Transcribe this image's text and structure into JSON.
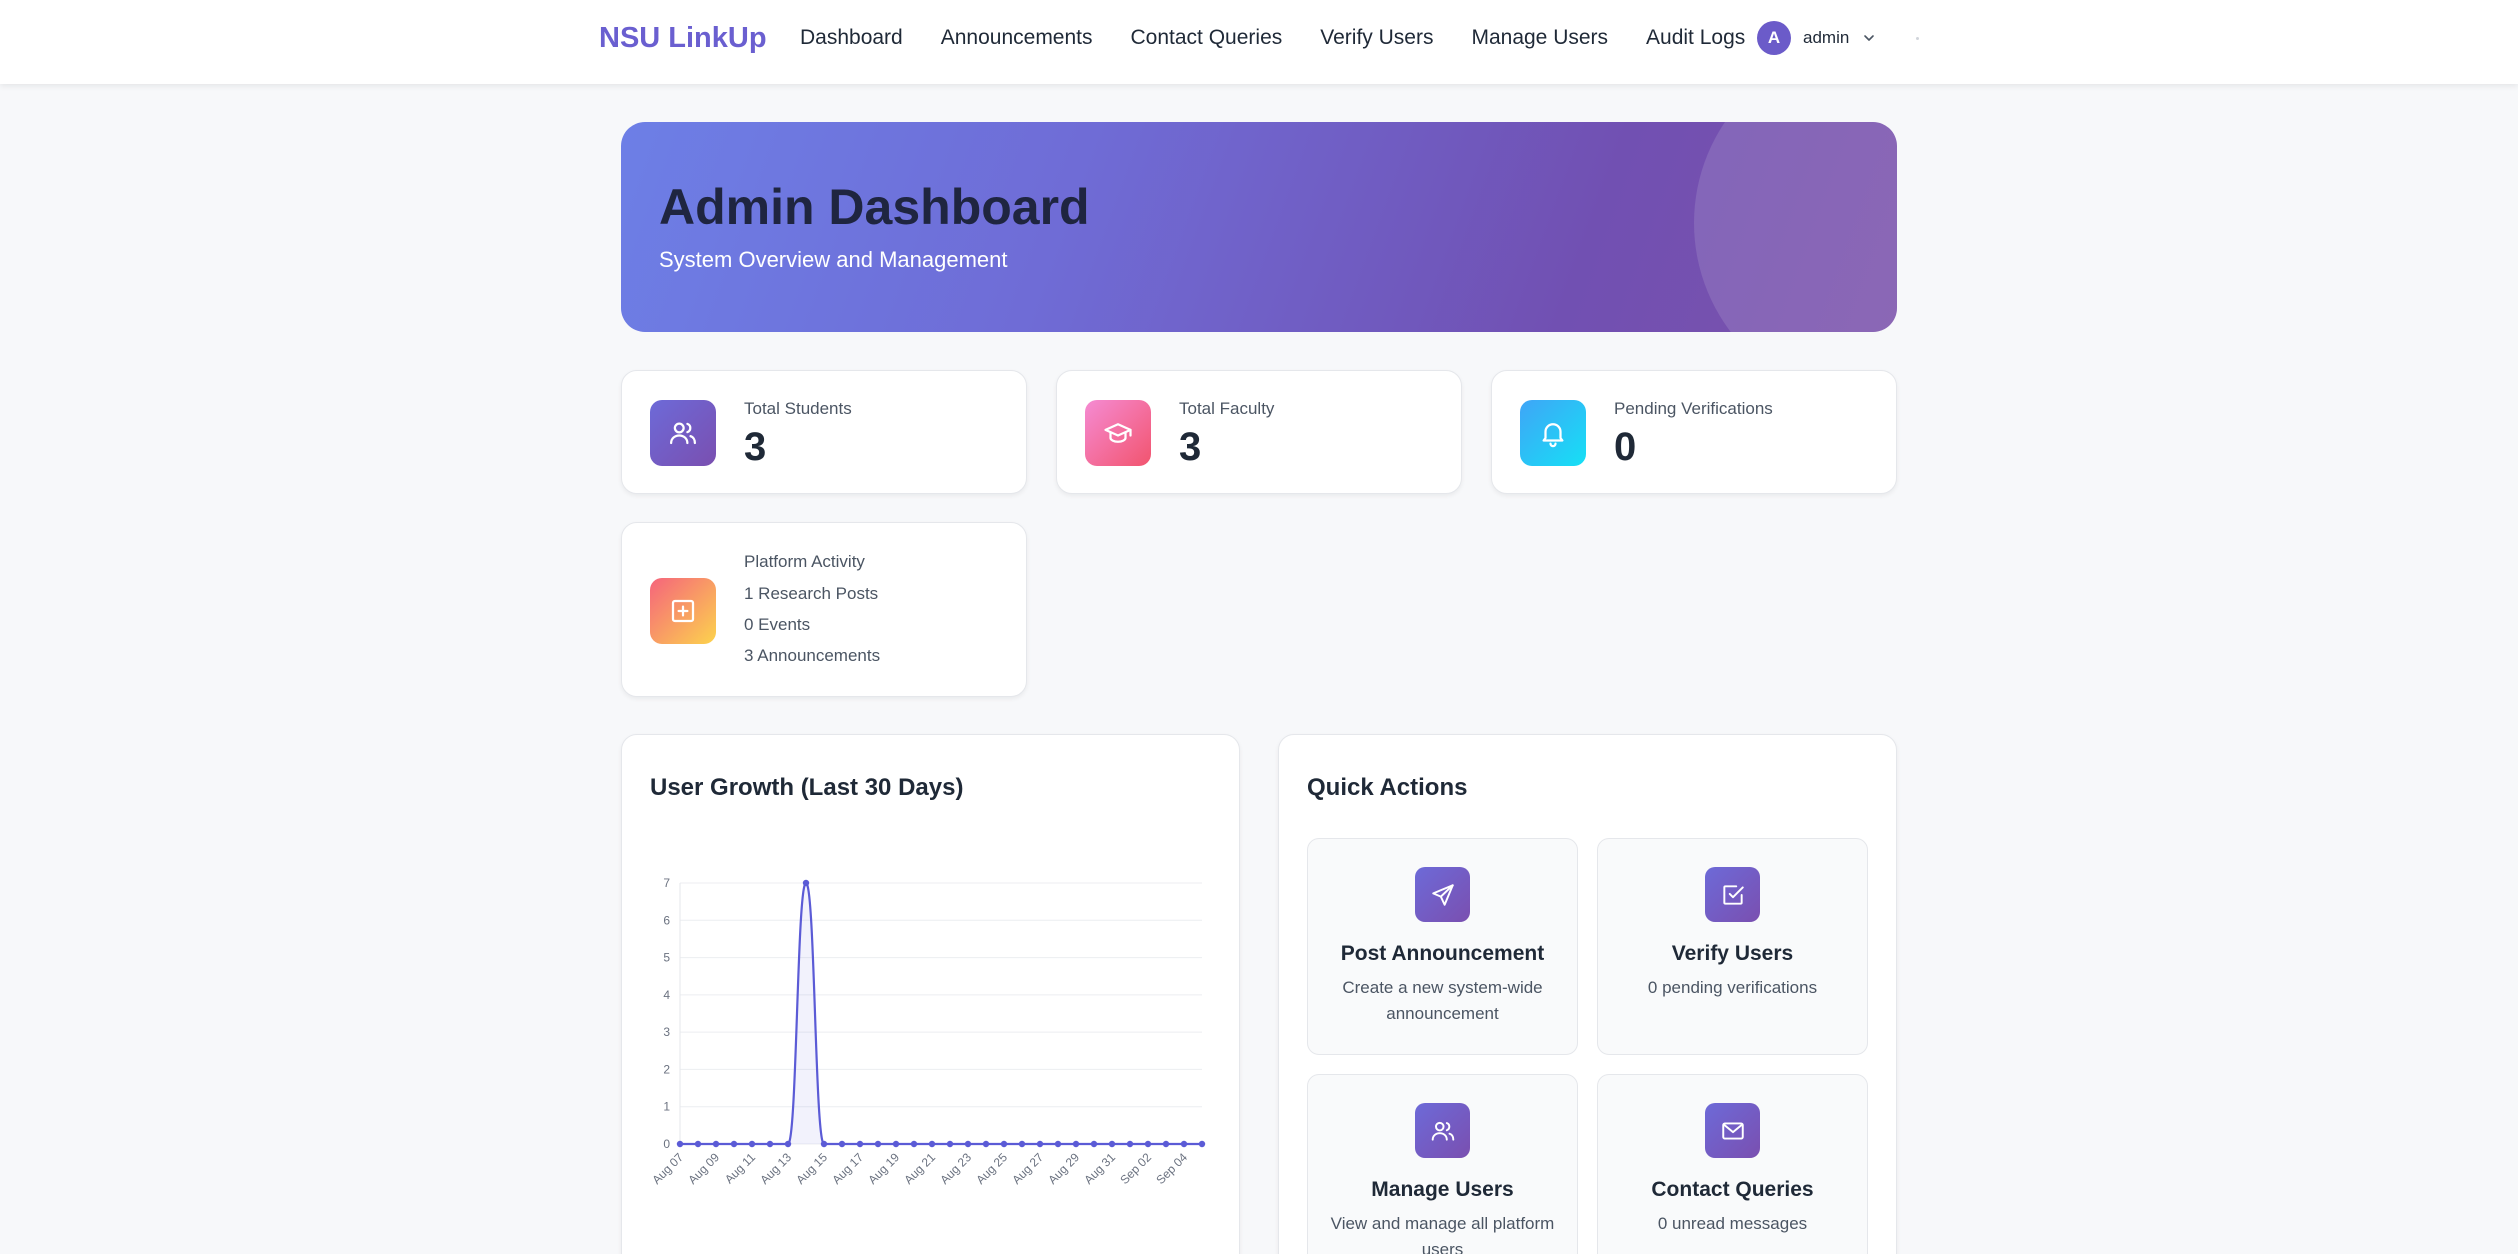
{
  "nav": {
    "brand": "NSU LinkUp",
    "links": [
      "Dashboard",
      "Announcements",
      "Contact Queries",
      "Verify Users",
      "Manage Users",
      "Audit Logs"
    ],
    "user": {
      "initial": "A",
      "name": "admin"
    }
  },
  "hero": {
    "title": "Admin Dashboard",
    "subtitle": "System Overview and Management"
  },
  "stats": [
    {
      "label": "Total Students",
      "value": "3",
      "icon": "users-icon",
      "color": "#6a5fd0"
    },
    {
      "label": "Total Faculty",
      "value": "3",
      "icon": "graduation-cap-icon",
      "color": "#f2618a"
    },
    {
      "label": "Pending Verifications",
      "value": "0",
      "icon": "bell-icon",
      "color": "#22c1f0"
    }
  ],
  "activity": {
    "label": "Platform Activity",
    "lines": [
      "1 Research Posts",
      "0 Events",
      "3 Announcements"
    ],
    "icon": "plus-square-icon"
  },
  "chart_card": {
    "title": "User Growth (Last 30 Days)"
  },
  "chart_data": {
    "type": "line",
    "title": "User Growth (Last 30 Days)",
    "xlabel": "",
    "ylabel": "",
    "x": [
      "Aug 07",
      "Aug 08",
      "Aug 09",
      "Aug 10",
      "Aug 11",
      "Aug 12",
      "Aug 13",
      "Aug 14",
      "Aug 15",
      "Aug 16",
      "Aug 17",
      "Aug 18",
      "Aug 19",
      "Aug 20",
      "Aug 21",
      "Aug 22",
      "Aug 23",
      "Aug 24",
      "Aug 25",
      "Aug 26",
      "Aug 27",
      "Aug 28",
      "Aug 29",
      "Aug 30",
      "Aug 31",
      "Sep 01",
      "Sep 02",
      "Sep 03",
      "Sep 04",
      "Sep 05"
    ],
    "x_tick_labels": [
      "Aug 07",
      "Aug 09",
      "Aug 11",
      "Aug 13",
      "Aug 15",
      "Aug 17",
      "Aug 19",
      "Aug 21",
      "Aug 23",
      "Aug 25",
      "Aug 27",
      "Aug 29",
      "Aug 31",
      "Sep 02",
      "Sep 04"
    ],
    "series": [
      {
        "values": [
          0,
          0,
          0,
          0,
          0,
          0,
          0,
          7,
          0,
          0,
          0,
          0,
          0,
          0,
          0,
          0,
          0,
          0,
          0,
          0,
          0,
          0,
          0,
          0,
          0,
          0,
          0,
          0,
          0,
          0
        ],
        "color": "#5b5bd6"
      }
    ],
    "ylim": [
      0,
      7
    ],
    "y_ticks": [
      0,
      1,
      2,
      3,
      4,
      5,
      6,
      7
    ],
    "grid": true,
    "legend": "none"
  },
  "quick_actions": {
    "title": "Quick Actions",
    "items": [
      {
        "title": "Post Announcement",
        "desc": "Create a new system-wide announcement",
        "icon": "send-icon"
      },
      {
        "title": "Verify Users",
        "desc": "0 pending verifications",
        "icon": "check-square-icon"
      },
      {
        "title": "Manage Users",
        "desc": "View and manage all platform users",
        "icon": "users-icon"
      },
      {
        "title": "Contact Queries",
        "desc": "0 unread messages",
        "icon": "mail-icon"
      }
    ]
  }
}
